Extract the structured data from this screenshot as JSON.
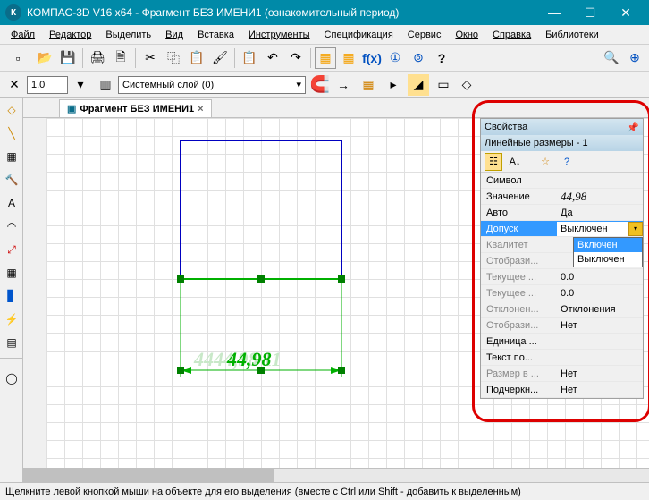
{
  "titlebar": {
    "app_icon_text": "К",
    "title": "КОМПАС-3D V16  x64 - Фрагмент БЕЗ ИМЕНИ1 (ознакомительный период)"
  },
  "menu": {
    "file": "Файл",
    "edit": "Редактор",
    "select": "Выделить",
    "view": "Вид",
    "insert": "Вставка",
    "tools": "Инструменты",
    "spec": "Спецификация",
    "service": "Сервис",
    "window": "Окно",
    "help": "Справка",
    "libs": "Библиотеки"
  },
  "toolbar1": {
    "new": "▫",
    "open": "📂",
    "save": "💾",
    "print": "🖨",
    "preview": "🗎",
    "cut": "✂",
    "copy": "⿻",
    "paste": "📋",
    "format": "🖌",
    "props": "📋",
    "undo": "↶",
    "redo": "↷",
    "mgr": "▦",
    "vars": "▦",
    "fx": "f(x)",
    "a1": "①",
    "a2": "⊚",
    "help": "?",
    "zoom": "🔍",
    "fit": "⊕"
  },
  "toolbar2": {
    "scale": "1.0",
    "layer_icon": "▥",
    "layer_name": "Системный слой (0)",
    "magnet": "🧲",
    "snap_arrow": "→",
    "grid": "▦",
    "axis": "▸",
    "ortho": "◢",
    "ex1": "▭",
    "ex2": "◇"
  },
  "tab": {
    "label": "Фрагмент БЕЗ ИМЕНИ1"
  },
  "canvas": {
    "dim_value": "44,98"
  },
  "props": {
    "title": "Свойства",
    "pin": "📌",
    "subtitle": "Линейные размеры - 1",
    "rows": {
      "symbol": {
        "label": "Символ",
        "value": ""
      },
      "value": {
        "label": "Значение",
        "value": "44,98"
      },
      "auto": {
        "label": "Авто",
        "value": "Да"
      },
      "tolerance": {
        "label": "Допуск",
        "value": "Выключен"
      },
      "qualitet": {
        "label": "Квалитет",
        "value": ""
      },
      "display": {
        "label": "Отобрази...",
        "value": ""
      },
      "cur1": {
        "label": "Текущее ...",
        "value": "0.0"
      },
      "cur2": {
        "label": "Текущее ...",
        "value": "0.0"
      },
      "deviation": {
        "label": "Отклонен...",
        "value": "Отклонения"
      },
      "display2": {
        "label": "Отобрази...",
        "value": "Нет"
      },
      "unit": {
        "label": "Единица ...",
        "value": ""
      },
      "textafter": {
        "label": "Текст по...",
        "value": ""
      },
      "sizein": {
        "label": "Размер в ...",
        "value": "Нет"
      },
      "underline": {
        "label": "Подчеркн...",
        "value": "Нет"
      }
    },
    "dropdown": {
      "opt_on": "Включен",
      "opt_off": "Выключен"
    }
  },
  "status": {
    "text": "Щелкните левой кнопкой мыши на объекте для его выделения (вместе с Ctrl или Shift - добавить к выделенным)"
  }
}
